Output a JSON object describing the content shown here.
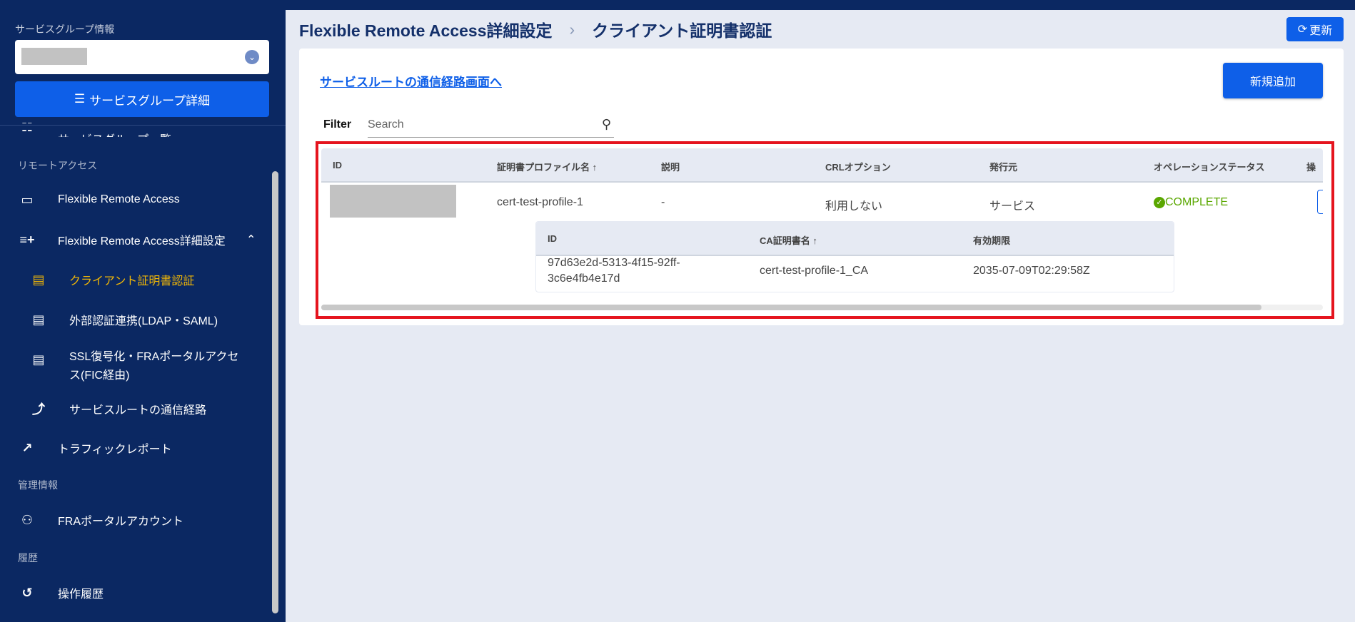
{
  "sidebar": {
    "service_group_label": "サービスグループ情報",
    "service_group_detail_button": "サービスグループ詳細",
    "clipped_item": "サービスグループ一覧",
    "sections": {
      "remote_access": "リモートアクセス",
      "management": "管理情報",
      "history": "履歴"
    },
    "items": {
      "fra": "Flexible Remote Access",
      "fra_detail": "Flexible Remote Access詳細設定",
      "client_cert": "クライアント証明書認証",
      "external_auth": "外部認証連携(LDAP・SAML)",
      "ssl": "SSL復号化・FRAポータルアクセス(FIC経由)",
      "service_route": "サービスルートの通信経路",
      "traffic": "トラフィックレポート",
      "portal_account": "FRAポータルアカウント",
      "operation_history": "操作履歴"
    }
  },
  "header": {
    "breadcrumb_parent": "Flexible Remote Access詳細設定",
    "breadcrumb_sep": "›",
    "breadcrumb_current": "クライアント証明書認証",
    "refresh_label": "更新"
  },
  "main": {
    "route_link": "サービスルートの通信経路画面へ",
    "add_button": "新規追加",
    "filter_label": "Filter",
    "search_placeholder": "Search",
    "table": {
      "headers": [
        "ID",
        "証明書プロファイル名 ↑",
        "説明",
        "CRLオプション",
        "発行元",
        "オペレーションステータス",
        "操"
      ],
      "row": {
        "profile_name": "cert-test-profile-1",
        "description": "-",
        "crl_option": "利用しない",
        "issuer": "サービス",
        "status": "COMPLETE"
      },
      "sub_table": {
        "headers": [
          "ID",
          "CA証明書名 ↑",
          "有効期限"
        ],
        "row": {
          "id_line1": "97d63e2d-5313-4f15-92ff-",
          "id_line2": "3c6e4fb4e17d",
          "ca_name": "cert-test-profile-1_CA",
          "expiry": "2035-07-09T02:29:58Z"
        }
      }
    }
  },
  "colors": {
    "sidebar_bg": "#0b2862",
    "primary": "#0e5fe8",
    "active": "#f2b705",
    "success": "#5aa700",
    "highlight": "#e5141e"
  }
}
